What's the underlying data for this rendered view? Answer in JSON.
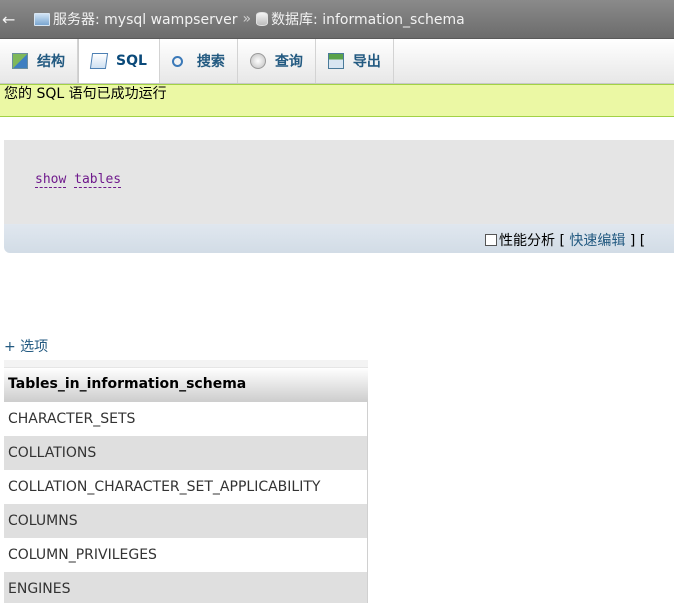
{
  "breadcrumb": {
    "back_glyph": "←",
    "server": "服务器: mysql wampserver",
    "separator": "»",
    "database": "数据库: information_schema"
  },
  "tabs": [
    {
      "label": "结构",
      "icon": "structure-icon"
    },
    {
      "label": "SQL",
      "icon": "sql-icon",
      "active": true
    },
    {
      "label": "搜索",
      "icon": "search-icon"
    },
    {
      "label": "查询",
      "icon": "query-icon"
    },
    {
      "label": "导出",
      "icon": "export-icon"
    }
  ],
  "message": {
    "success": "您的 SQL 语句已成功运行",
    "color": "#ebf8a4"
  },
  "query": {
    "word1": "show",
    "word2": "tables"
  },
  "query_footer": {
    "profiling_label": "性能分析",
    "bracket_open": "[",
    "inline_edit": "快速编辑",
    "bracket_close": "] ["
  },
  "options": {
    "label": "+ 选项"
  },
  "results": {
    "header": "Tables_in_information_schema",
    "rows": [
      "CHARACTER_SETS",
      "COLLATIONS",
      "COLLATION_CHARACTER_SET_APPLICABILITY",
      "COLUMNS",
      "COLUMN_PRIVILEGES",
      "ENGINES"
    ]
  },
  "colors": {
    "link": "#235a81",
    "breadcrumb_bg": "#7a7a7a",
    "sql_text": "#6f1a8c"
  }
}
